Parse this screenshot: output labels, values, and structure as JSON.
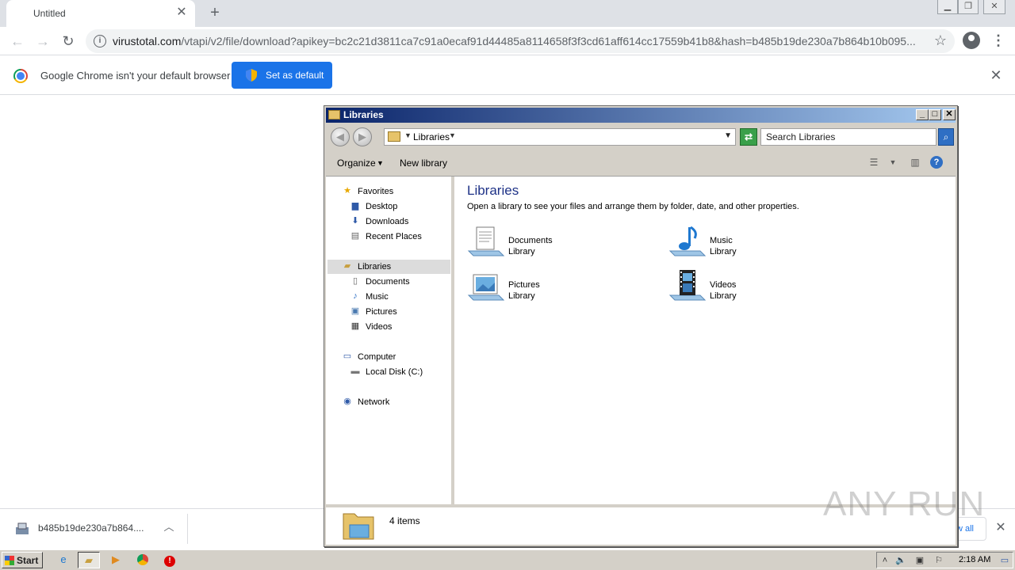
{
  "browser": {
    "tab_title": "Untitled",
    "url_host": "virustotal.com",
    "url_path": "/vtapi/v2/file/download?apikey=bc2c21d3811ca7c91a0ecaf91d44485a8114658f3f3cd61aff614cc17559b41b8&hash=b485b19de230a7b864b10b095...",
    "infobar_text": "Google Chrome isn't your default browser",
    "set_default_label": "Set as default",
    "download_name": "b485b19de230a7b864....",
    "show_all_label": "w all"
  },
  "explorer": {
    "title": "Libraries",
    "address": "Libraries",
    "search_placeholder": "Search Libraries",
    "commands": {
      "organize": "Organize",
      "new_library": "New library"
    },
    "nav": {
      "favorites": "Favorites",
      "desktop": "Desktop",
      "downloads": "Downloads",
      "recent": "Recent Places",
      "libraries": "Libraries",
      "documents": "Documents",
      "music": "Music",
      "pictures": "Pictures",
      "videos": "Videos",
      "computer": "Computer",
      "local_disk": "Local Disk (C:)",
      "network": "Network"
    },
    "content_title": "Libraries",
    "content_subtitle": "Open a library to see your files and arrange them by folder, date, and other properties.",
    "libraries": [
      {
        "name": "Documents",
        "type": "Library"
      },
      {
        "name": "Music",
        "type": "Library"
      },
      {
        "name": "Pictures",
        "type": "Library"
      },
      {
        "name": "Videos",
        "type": "Library"
      }
    ],
    "status": "4 items"
  },
  "watermark": "ANY RUN",
  "taskbar": {
    "start_label": "Start",
    "clock": "2:18 AM"
  }
}
